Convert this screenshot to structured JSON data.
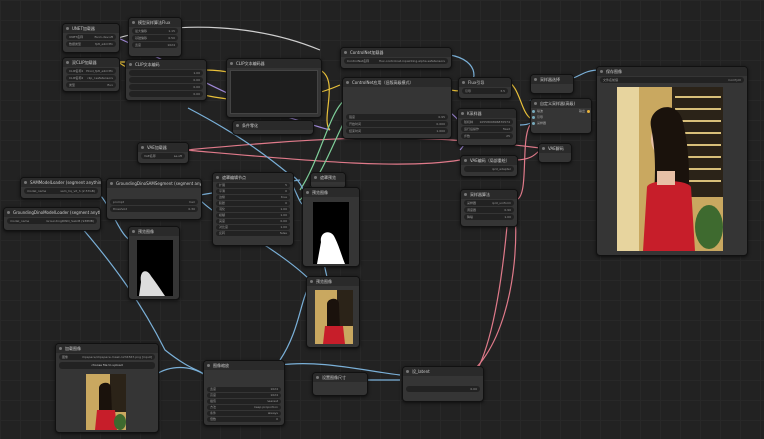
{
  "canvas_title": "ComfyUI workflow",
  "nodes": {
    "unet": {
      "title": "UNET加载器",
      "rows": [
        [
          "UNET名称",
          "flux1-dev.sft"
        ],
        [
          "数据类型",
          "fp8_e4m3fn"
        ]
      ]
    },
    "model_sampling": {
      "title": "模型采样算法Flux",
      "rows": [
        [
          "最大偏移",
          "1.15"
        ],
        [
          "基础偏移",
          "0.50"
        ],
        [
          "宽度",
          "1024"
        ],
        [
          "高度",
          "1024"
        ]
      ]
    },
    "dual_clip": {
      "title": "双CLIP加载器",
      "rows": [
        [
          "CLIP名称1",
          "t5xxl_fp8_e4m3fn"
        ],
        [
          "CLIP名称2",
          "clip_l.safetensors"
        ],
        [
          "类型",
          "flux"
        ]
      ]
    },
    "clip_text": {
      "title": "CLIP文本编码",
      "rows": [
        [
          "",
          "1.00"
        ],
        [
          "",
          "0.00"
        ],
        [
          "",
          "0.00"
        ],
        [
          "",
          "0.00"
        ]
      ]
    },
    "clip_text2": {
      "title": "CLIP文本编码器"
    },
    "neg_prompt": {
      "title": "条件零化"
    },
    "controlnet_loader": {
      "title": "ControlNet加载器",
      "rows": [
        [
          "ControlNet名称",
          "flux-controlnet-inpainting-alpha.safetensors"
        ]
      ]
    },
    "controlnet_apply": {
      "title": "ControlNet应用（旧版高级模式）",
      "rows": [
        [
          "强度",
          "0.95"
        ],
        [
          "开始时间",
          "0.000"
        ],
        [
          "结束时间",
          "1.000"
        ]
      ]
    },
    "flux_guidance": {
      "title": "Flux引导",
      "rows": [
        [
          "引导",
          "3.5"
        ]
      ]
    },
    "ksampler": {
      "title": "K采样器",
      "rows": [
        [
          "随机种",
          "1055809896870574"
        ],
        [
          "运行后操作",
          "fixed"
        ],
        [
          "步数",
          "25"
        ],
        [
          "CFG",
          "1.0"
        ]
      ]
    },
    "vae_loader": {
      "title": "VAE加载器",
      "rows": [
        [
          "VAE名称",
          "ae.sft"
        ]
      ]
    },
    "vae_decode": {
      "title": "VAE解码"
    },
    "vae_encode": {
      "title": "VAE编码（局部重绘）",
      "rows": [
        [
          "",
          "ipnt_adapter"
        ]
      ]
    },
    "ksampler_adv": {
      "title": "采样器算法",
      "rows": [
        [
          "采样器",
          "ipnt_uniform"
        ],
        [
          "调度器",
          "0.90"
        ],
        [
          "降噪",
          "1.00"
        ]
      ]
    },
    "sam_loader": {
      "title": "SAMModelLoader (segment anything)",
      "rows": [
        [
          "model_name",
          "sam_hq_vit_h (2.57GB)"
        ]
      ]
    },
    "gdino_loader": {
      "title": "GroundingDinoModelLoader (segment anything)",
      "rows": [
        [
          "model_name",
          "GroundingDINO_SwinB (938MB)"
        ]
      ]
    },
    "gdino_sam": {
      "title": "GroundingDinoSAMSegment (segment anything)",
      "rows": [
        [
          "prompt",
          "hair"
        ],
        [
          "threshold",
          "0.30"
        ]
      ]
    },
    "mask_process": {
      "title": "遮罩编辑节点",
      "rows": [
        [
          "扩展",
          "5"
        ],
        [
          "平滑",
          "0"
        ],
        [
          "边缘",
          "true"
        ],
        [
          "膨胀",
          "0"
        ],
        [
          "羽化",
          "1.00"
        ],
        [
          "模糊",
          "1.00"
        ],
        [
          "亮度",
          "0.00"
        ],
        [
          "对比度",
          "1.00"
        ],
        [
          "反转",
          "false"
        ]
      ]
    },
    "preview_mask": {
      "title": "遮罩预览"
    },
    "preview_mask2": {
      "title": "预览图像"
    },
    "preview_top": {
      "title": "预览图像"
    },
    "preview_mid": {
      "title": "预览图像"
    },
    "preview_mask_left": {
      "title": "预览图像"
    },
    "save_image": {
      "title": "保存图像",
      "rows": [
        [
          "文件名前缀",
          "ComfyUI"
        ]
      ]
    },
    "load_image": {
      "title": "加载图像",
      "rows": [
        [
          "图像",
          "clipspace/clipspace-mask-1234567.png [input]"
        ]
      ],
      "button": "choose file to upload"
    },
    "image_scale": {
      "title": "图像缩放",
      "rows": [
        [
          "宽度",
          "1024"
        ],
        [
          "高度",
          "1024"
        ],
        [
          "插值",
          "nearest"
        ],
        [
          "方法",
          "keep proportion"
        ],
        [
          "条件",
          "always"
        ],
        [
          "倍数",
          "0"
        ]
      ]
    },
    "image_scale_side": {
      "title": "设置图像尺寸"
    },
    "latent": {
      "title": "设_latent",
      "rows": [
        [
          "",
          "0.00"
        ]
      ]
    }
  },
  "colors": {
    "wire_blue": "#7ab0d8",
    "wire_pink": "#e07a8a",
    "wire_yellow": "#e9c13a",
    "wire_purple": "#a089d8",
    "wire_green": "#7fcf9a",
    "wire_white": "#cfcfcf"
  }
}
